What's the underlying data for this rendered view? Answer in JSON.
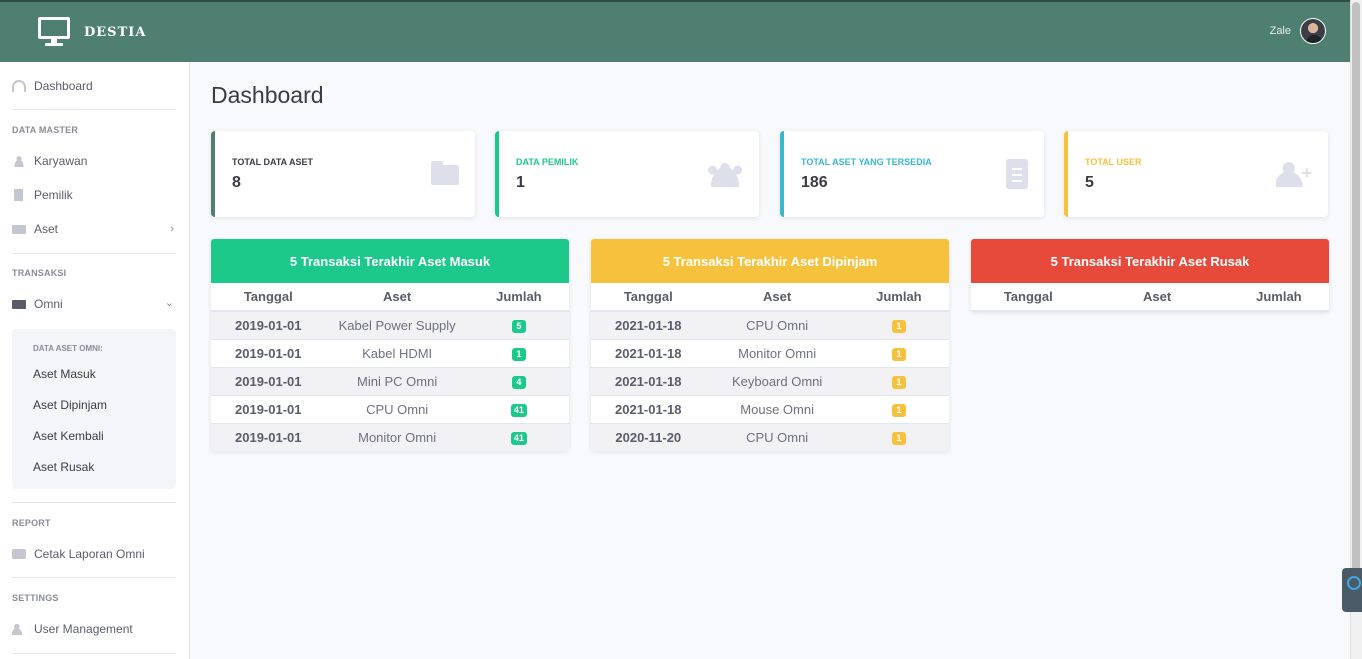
{
  "brand": {
    "name": "DESTIA"
  },
  "user": {
    "name": "Zale"
  },
  "colors": {
    "topbar": "#4e7f70",
    "primary": "#4e73df",
    "success": "#1cc88a",
    "info": "#36b9cc",
    "warning": "#f6c23e",
    "danger": "#e74a3b"
  },
  "sidebar": {
    "dashboard": "Dashboard",
    "sections": {
      "master": "DATA MASTER",
      "transaksi": "TRANSAKSI",
      "report": "REPORT",
      "settings": "SETTINGS"
    },
    "master_items": [
      "Karyawan",
      "Pemilik",
      "Aset"
    ],
    "omni": "Omni",
    "omni_sub_header": "DATA ASET OMNI:",
    "omni_sub_items": [
      "Aset Masuk",
      "Aset Dipinjam",
      "Aset Kembali",
      "Aset Rusak"
    ],
    "report_item": "Cetak Laporan Omni",
    "settings_item": "User Management"
  },
  "page": {
    "title": "Dashboard"
  },
  "cards": [
    {
      "label": "TOTAL DATA ASET",
      "value": "8",
      "icon": "folder-icon"
    },
    {
      "label": "DATA PEMILIK",
      "value": "1",
      "icon": "users-icon"
    },
    {
      "label": "TOTAL ASET YANG TERSEDIA",
      "value": "186",
      "icon": "clipboard-list-icon"
    },
    {
      "label": "TOTAL USER",
      "value": "5",
      "icon": "user-plus-icon"
    }
  ],
  "tables": {
    "headers": [
      "Tanggal",
      "Aset",
      "Jumlah"
    ],
    "masuk": {
      "title": "5 Transaksi Terakhir Aset Masuk",
      "rows": [
        [
          "2019-01-01",
          "Kabel Power Supply",
          "5"
        ],
        [
          "2019-01-01",
          "Kabel HDMI",
          "1"
        ],
        [
          "2019-01-01",
          "Mini PC Omni",
          "4"
        ],
        [
          "2019-01-01",
          "CPU Omni",
          "41"
        ],
        [
          "2019-01-01",
          "Monitor Omni",
          "41"
        ]
      ]
    },
    "dipinjam": {
      "title": "5 Transaksi Terakhir Aset Dipinjam",
      "rows": [
        [
          "2021-01-18",
          "CPU Omni",
          "1"
        ],
        [
          "2021-01-18",
          "Monitor Omni",
          "1"
        ],
        [
          "2021-01-18",
          "Keyboard Omni",
          "1"
        ],
        [
          "2021-01-18",
          "Mouse Omni",
          "1"
        ],
        [
          "2020-11-20",
          "CPU Omni",
          "1"
        ]
      ]
    },
    "rusak": {
      "title": "5 Transaksi Terakhir Aset Rusak",
      "rows": []
    }
  }
}
